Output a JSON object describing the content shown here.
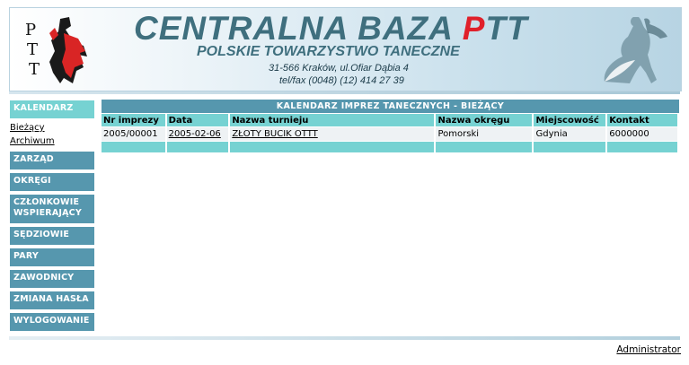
{
  "header": {
    "title_prefix": "CENTRALNA BAZA ",
    "title_accent": "P",
    "title_suffix": "TT",
    "subtitle": "POLSKIE TOWARZYSTWO TANECZNE",
    "address": "31-566 Kraków, ul.Ofiar Dąbia 4",
    "phone": "tel/fax (0048) (12) 414 27 39",
    "logo_text": "PTT",
    "colors": {
      "title": "#3f6f7e",
      "accent": "#e0202a"
    }
  },
  "sidebar": {
    "active": "KALENDARZ",
    "sub_links": [
      "Bieżący",
      "Archiwum"
    ],
    "items": [
      "ZARZĄD",
      "OKRĘGI",
      "CZŁONKOWIE WSPIERAJĄCY",
      "SĘDZIOWIE",
      "PARY",
      "ZAWODNICY",
      "ZMIANA HASŁA",
      "WYLOGOWANIE"
    ],
    "colors": {
      "button": "#5697ae",
      "active": "#76d2d2"
    }
  },
  "main": {
    "table_title": "KALENDARZ IMPREZ TANECZNYCH - BIEŻĄCY",
    "columns": [
      "Nr imprezy",
      "Data",
      "Nazwa turnieju",
      "Nazwa okręgu",
      "Miejscowość",
      "Kontakt"
    ],
    "rows": [
      [
        "2005/00001",
        "2005-02-06",
        "ZŁOTY BUCIK OTTT",
        "Pomorski",
        "Gdynia",
        "6000000"
      ]
    ]
  },
  "footer": {
    "user_link": "Administrator"
  }
}
